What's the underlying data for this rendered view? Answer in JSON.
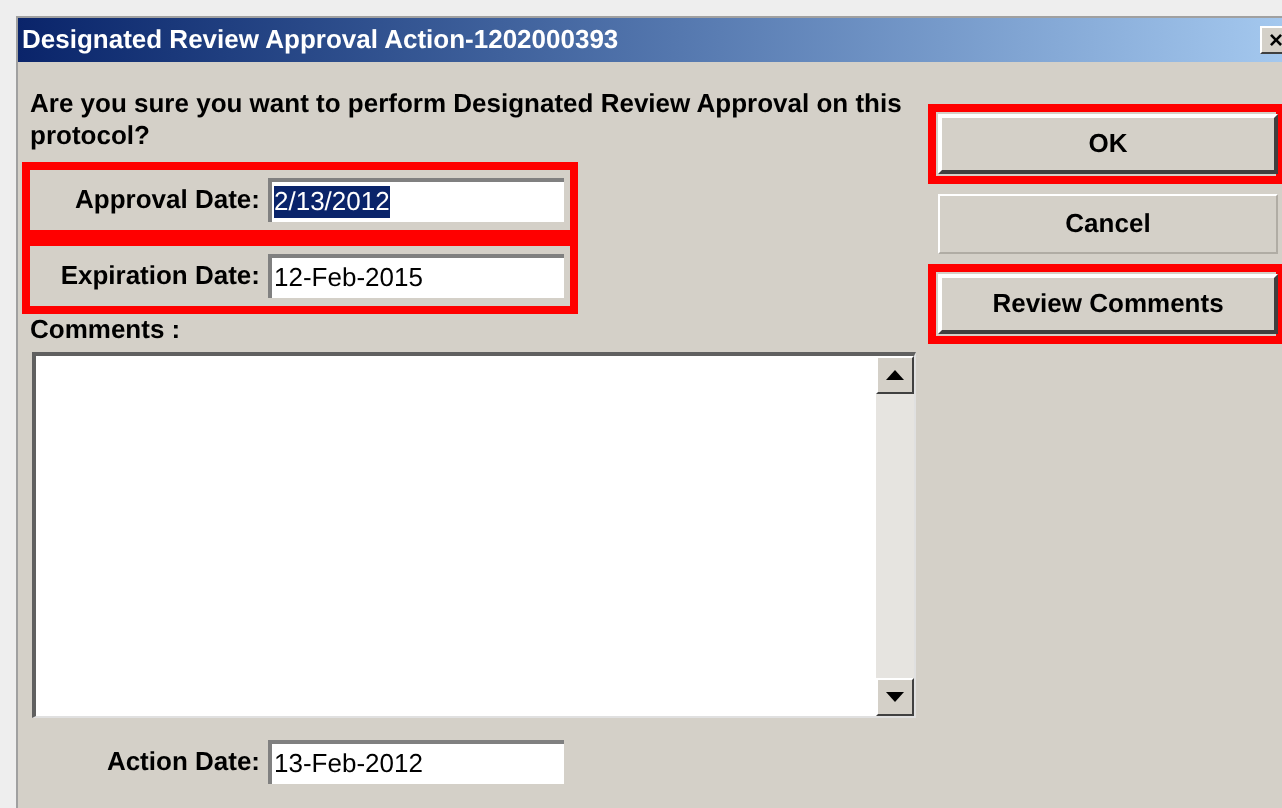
{
  "window": {
    "title": "Designated Review Approval Action-1202000393",
    "close": "×"
  },
  "question": "Are you sure you want to perform Designated Review Approval on this protocol?",
  "date_fields": [
    {
      "label": "Approval Date:",
      "value": "2/13/2012",
      "text_selected": true,
      "highlighted": true
    },
    {
      "label": "Expiration Date:",
      "value": "12-Feb-2015",
      "text_selected": false,
      "highlighted": true
    }
  ],
  "comments": {
    "label": "Comments :"
  },
  "action_date": {
    "label": "Action Date:",
    "value": "13-Feb-2012",
    "text_selected": false
  },
  "buttons": [
    {
      "label": "OK",
      "highlighted": true,
      "kind": "raised"
    },
    {
      "label": "Cancel",
      "highlighted": false,
      "kind": "flat"
    },
    {
      "label": "Review Comments",
      "highlighted": true,
      "kind": "raised"
    }
  ]
}
